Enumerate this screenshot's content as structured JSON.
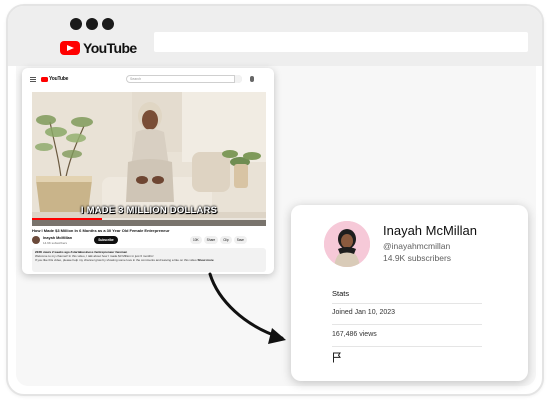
{
  "browser": {
    "brand": "YouTube",
    "icons": {
      "logo": "youtube-logo-icon",
      "window_controls": "window-dot-icon"
    }
  },
  "youtube_page": {
    "search_placeholder": "Search",
    "video": {
      "caption": "I MADE 3 MILLION DOLLARS",
      "progress_fraction": 0.3
    },
    "title": "How I Made $3 Million In 6 Months as a 30 Year Old Female Entrepreneur",
    "channel": {
      "name": "Inayah McMillan",
      "subscribers": "14.9K subscribers",
      "subscribe_label": "Subscribe"
    },
    "actions": {
      "likes": "10K",
      "share": "Share",
      "clip": "Clip",
      "save": "Save"
    },
    "description": {
      "meta": "223K views  2 weeks ago  #startabusiness #entrepreneur #women",
      "line1": "Welcome to my channel! In this video, I talk about how I made $3 Million in just 6 months!",
      "line2": "If you like this video, please help my channel grow by showing some love in the comments and leaving a like on this video",
      "more": "Show more"
    }
  },
  "channel_card": {
    "name": "Inayah McMillan",
    "handle": "@inayahmcmillan",
    "subscribers": "14.9K subscribers",
    "stats_title": "Stats",
    "joined": "Joined Jan 10, 2023",
    "views": "167,486 views",
    "report_icon": "flag-icon"
  },
  "colors": {
    "brand_red": "#ff0000",
    "chrome_gray": "#eeeeee",
    "avatar_pink": "#f6c9d8"
  }
}
